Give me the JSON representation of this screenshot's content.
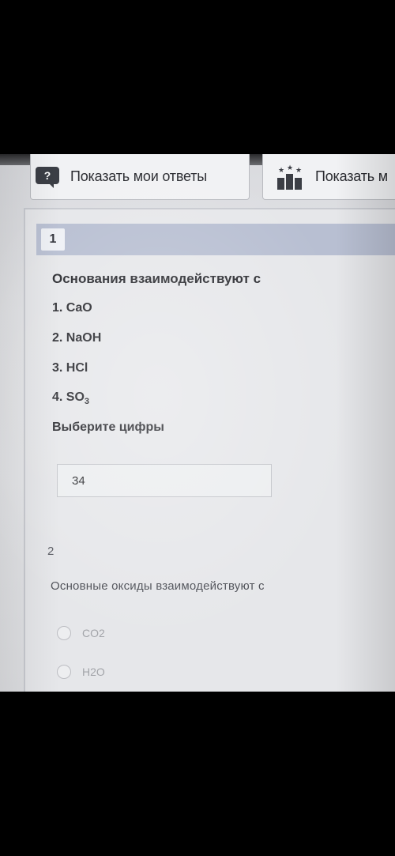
{
  "toolbar": {
    "help_icon_glyph": "?",
    "show_my_answers_label": "Показать мои ответы",
    "show_other_label": "Показать м"
  },
  "question1": {
    "number": "1",
    "title": "Основания взаимодействуют с",
    "options": [
      {
        "prefix": "1. ",
        "formula": "CaO",
        "sub": ""
      },
      {
        "prefix": "2. ",
        "formula": "NaOH",
        "sub": ""
      },
      {
        "prefix": "3. ",
        "formula": "HCl",
        "sub": ""
      },
      {
        "prefix": "4. ",
        "formula": "SO",
        "sub": "3"
      }
    ],
    "prompt": "Выберите цифры",
    "answer_value": "34"
  },
  "question2": {
    "number": "2",
    "title": "Основные оксиды взаимодействуют с",
    "options": [
      {
        "label": "CO2"
      },
      {
        "label": "H2O"
      }
    ]
  },
  "colors": {
    "header_band": "#b8bfd2",
    "icon_dark": "#3b3e45"
  },
  "icons": [
    "help-question-icon",
    "ranking-icon"
  ]
}
